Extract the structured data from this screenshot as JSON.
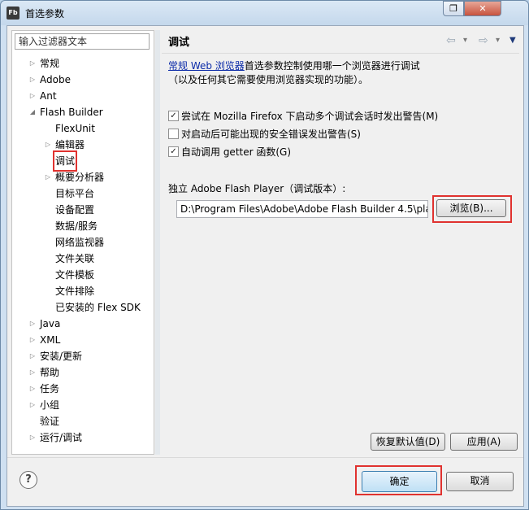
{
  "window": {
    "title": "首选参数",
    "icon_label": "Fb",
    "restore_glyph": "❐",
    "close_glyph": "✕"
  },
  "left_panel": {
    "filter_placeholder": "输入过滤器文本",
    "tree": [
      {
        "label": "常规",
        "indent": 0,
        "arrow": "collapsed"
      },
      {
        "label": "Adobe",
        "indent": 0,
        "arrow": "collapsed"
      },
      {
        "label": "Ant",
        "indent": 0,
        "arrow": "collapsed"
      },
      {
        "label": "Flash Builder",
        "indent": 0,
        "arrow": "expanded"
      },
      {
        "label": "FlexUnit",
        "indent": 1,
        "arrow": "none"
      },
      {
        "label": "编辑器",
        "indent": 1,
        "arrow": "collapsed"
      },
      {
        "label": "调试",
        "indent": 1,
        "arrow": "none",
        "selected": true
      },
      {
        "label": "概要分析器",
        "indent": 1,
        "arrow": "collapsed"
      },
      {
        "label": "目标平台",
        "indent": 1,
        "arrow": "none"
      },
      {
        "label": "设备配置",
        "indent": 1,
        "arrow": "none"
      },
      {
        "label": "数据/服务",
        "indent": 1,
        "arrow": "none"
      },
      {
        "label": "网络监视器",
        "indent": 1,
        "arrow": "none"
      },
      {
        "label": "文件关联",
        "indent": 1,
        "arrow": "none"
      },
      {
        "label": "文件模板",
        "indent": 1,
        "arrow": "none"
      },
      {
        "label": "文件排除",
        "indent": 1,
        "arrow": "none"
      },
      {
        "label": "已安装的 Flex SDK",
        "indent": 1,
        "arrow": "none"
      },
      {
        "label": "Java",
        "indent": 0,
        "arrow": "collapsed"
      },
      {
        "label": "XML",
        "indent": 0,
        "arrow": "collapsed"
      },
      {
        "label": "安装/更新",
        "indent": 0,
        "arrow": "collapsed"
      },
      {
        "label": "帮助",
        "indent": 0,
        "arrow": "collapsed"
      },
      {
        "label": "任务",
        "indent": 0,
        "arrow": "collapsed"
      },
      {
        "label": "小组",
        "indent": 0,
        "arrow": "collapsed"
      },
      {
        "label": "验证",
        "indent": 0,
        "arrow": "none"
      },
      {
        "label": "运行/调试",
        "indent": 0,
        "arrow": "collapsed"
      }
    ]
  },
  "right_panel": {
    "title": "调试",
    "nav": {
      "back_glyph": "⇦",
      "forward_glyph": "⇨",
      "dropdown_glyph": "▾",
      "menu_glyph": "▼"
    },
    "description": {
      "link_text": "常规 Web 浏览器",
      "line1_rest": "首选参数控制使用哪一个浏览器进行调试",
      "line2": "（以及任何其它需要使用浏览器实现的功能）。"
    },
    "checkboxes": [
      {
        "label": "尝试在 Mozilla Firefox 下启动多个调试会话时发出警告(M)",
        "checked": true,
        "mark": "✓"
      },
      {
        "label": "对启动后可能出现的安全错误发出警告(S)",
        "checked": false,
        "mark": ""
      },
      {
        "label": "自动调用 getter 函数(G)",
        "checked": true,
        "mark": "✓"
      }
    ],
    "flash_player_label": "独立 Adobe Flash Player（调试版本）:",
    "flash_player_path": "D:\\Program Files\\Adobe\\Adobe Flash Builder 4.5\\pla",
    "browse_label": "浏览(B)...",
    "restore_defaults_label": "恢复默认值(D)",
    "apply_label": "应用(A)"
  },
  "footer": {
    "help_glyph": "?",
    "ok_label": "确定",
    "cancel_label": "取消"
  },
  "colors": {
    "highlight": "#e0322f",
    "link": "#0a2aa8"
  }
}
